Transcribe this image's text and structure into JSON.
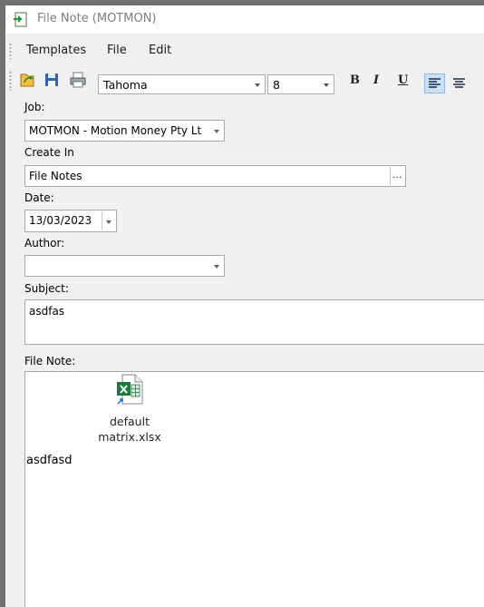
{
  "window": {
    "title": "File Note (MOTMON)"
  },
  "menu": {
    "items": [
      "Templates",
      "File",
      "Edit"
    ]
  },
  "toolbar": {
    "font_name": "Tahoma",
    "font_size": "8",
    "bold_label": "B",
    "italic_label": "I",
    "underline_label": "U"
  },
  "form": {
    "job_label": "Job:",
    "job_value": "MOTMON - Motion Money Pty Lt",
    "create_in_label": "Create In",
    "create_in_value": "File Notes",
    "browse_label": "...",
    "date_label": "Date:",
    "date_value": "13/03/2023",
    "author_label": "Author:",
    "author_value": "",
    "subject_label": "Subject:",
    "subject_value": "asdfas",
    "file_note_label": "File Note:",
    "attachment_name_line1": "default",
    "attachment_name_line2": "matrix.xlsx",
    "note_text": "asdfasd"
  },
  "colors": {
    "excel_green": "#1d7a3f",
    "active_blue": "#c9e0f7"
  }
}
